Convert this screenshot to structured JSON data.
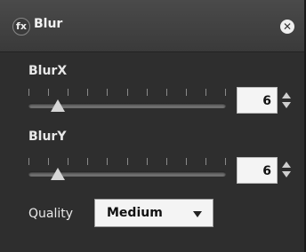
{
  "panel": {
    "icon": "fx-icon",
    "title": "Blur",
    "close_icon": "close-icon"
  },
  "blur_x": {
    "label": "BlurX",
    "value": "6",
    "slider_fraction": 0.15
  },
  "blur_y": {
    "label": "BlurY",
    "value": "6",
    "slider_fraction": 0.15
  },
  "quality": {
    "label": "Quality",
    "selected": "Medium"
  }
}
